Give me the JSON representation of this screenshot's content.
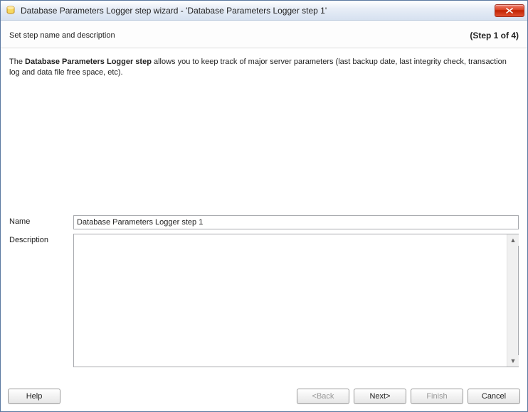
{
  "window": {
    "title": "Database Parameters Logger step wizard - 'Database Parameters Logger step 1'"
  },
  "subheader": {
    "title": "Set step name and description",
    "step_indicator": "(Step 1 of 4)"
  },
  "intro": {
    "prefix": "The ",
    "bold": "Database Parameters Logger step",
    "rest": " allows you to keep track of major server parameters (last backup date, last integrity check, transaction log and data file free space, etc)."
  },
  "form": {
    "name_label": "Name",
    "name_value": "Database Parameters Logger step 1",
    "description_label": "Description",
    "description_value": ""
  },
  "buttons": {
    "help": "Help",
    "back": "<Back",
    "next": "Next>",
    "finish": "Finish",
    "cancel": "Cancel"
  }
}
